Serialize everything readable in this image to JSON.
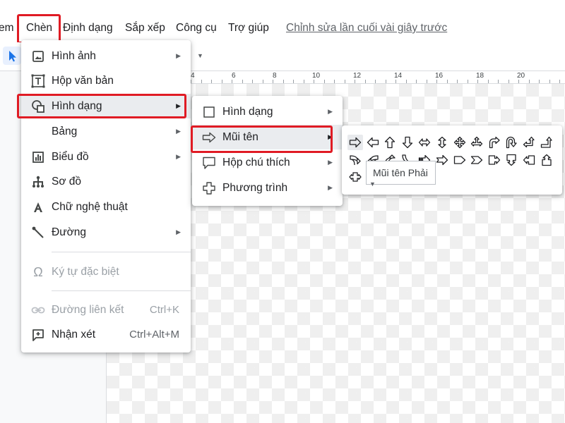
{
  "menubar": {
    "partial_left": "em",
    "items": [
      "Chèn",
      "Định dạng",
      "Sắp xếp",
      "Công cụ",
      "Trợ giúp"
    ],
    "last_edit": "Chỉnh sửa lần cuối vài giây trước"
  },
  "ruler": {
    "numbers": [
      "4",
      "6",
      "8",
      "10",
      "12",
      "14",
      "16",
      "18",
      "20"
    ]
  },
  "insert_menu": {
    "items": [
      {
        "label": "Hình ảnh",
        "icon": "image-icon",
        "submenu": true
      },
      {
        "label": "Hộp văn bản",
        "icon": "text-box-icon",
        "submenu": false
      },
      {
        "label": "Hình dạng",
        "icon": "shape-icon",
        "submenu": true,
        "active": true
      },
      {
        "label": "Bảng",
        "icon": "",
        "submenu": true
      },
      {
        "label": "Biểu đồ",
        "icon": "chart-icon",
        "submenu": true
      },
      {
        "label": "Sơ đồ",
        "icon": "diagram-icon",
        "submenu": false
      },
      {
        "label": "Chữ nghệ thuật",
        "icon": "word-art-icon",
        "submenu": false
      },
      {
        "label": "Đường",
        "icon": "line-icon",
        "submenu": true
      },
      {
        "label": "Ký tự đặc biệt",
        "icon": "omega-icon",
        "disabled": true
      },
      {
        "label": "Đường liên kết",
        "icon": "link-icon",
        "disabled": true,
        "shortcut": "Ctrl+K"
      },
      {
        "label": "Nhận xét",
        "icon": "comment-add-icon",
        "shortcut": "Ctrl+Alt+M"
      }
    ]
  },
  "shape_menu": {
    "items": [
      {
        "label": "Hình dạng",
        "icon": "square-icon"
      },
      {
        "label": "Mũi tên",
        "icon": "arrow-right-outline-icon",
        "active": true
      },
      {
        "label": "Hộp chú thích",
        "icon": "callout-icon"
      },
      {
        "label": "Phương trình",
        "icon": "plus-outline-icon"
      }
    ]
  },
  "arrow_palette": {
    "tooltip": "Mũi tên Phải",
    "selected_index": 0,
    "icons": [
      "right-arrow-icon",
      "left-arrow-icon",
      "up-arrow-icon",
      "down-arrow-icon",
      "left-right-arrow-icon",
      "up-down-arrow-icon",
      "quad-arrow-icon",
      "left-right-up-arrow-icon",
      "bent-arrow-icon",
      "u-turn-arrow-icon",
      "left-up-arrow-icon",
      "bent-up-arrow-icon",
      "curved-right-arrow-icon",
      "curved-left-arrow-icon",
      "curved-up-arrow-icon",
      "curved-down-arrow-icon",
      "striped-right-arrow-icon",
      "notched-right-arrow-icon",
      "pentagon-arrow-icon",
      "chevron-arrow-icon",
      "right-arrow-callout-icon",
      "down-arrow-callout-icon",
      "left-arrow-callout-icon",
      "up-arrow-callout-icon",
      "left-right-arrow-callout-icon"
    ]
  },
  "colors": {
    "highlight": "#e01b24",
    "active_row": "#eaecef",
    "selected_cell": "#e8eaed"
  }
}
